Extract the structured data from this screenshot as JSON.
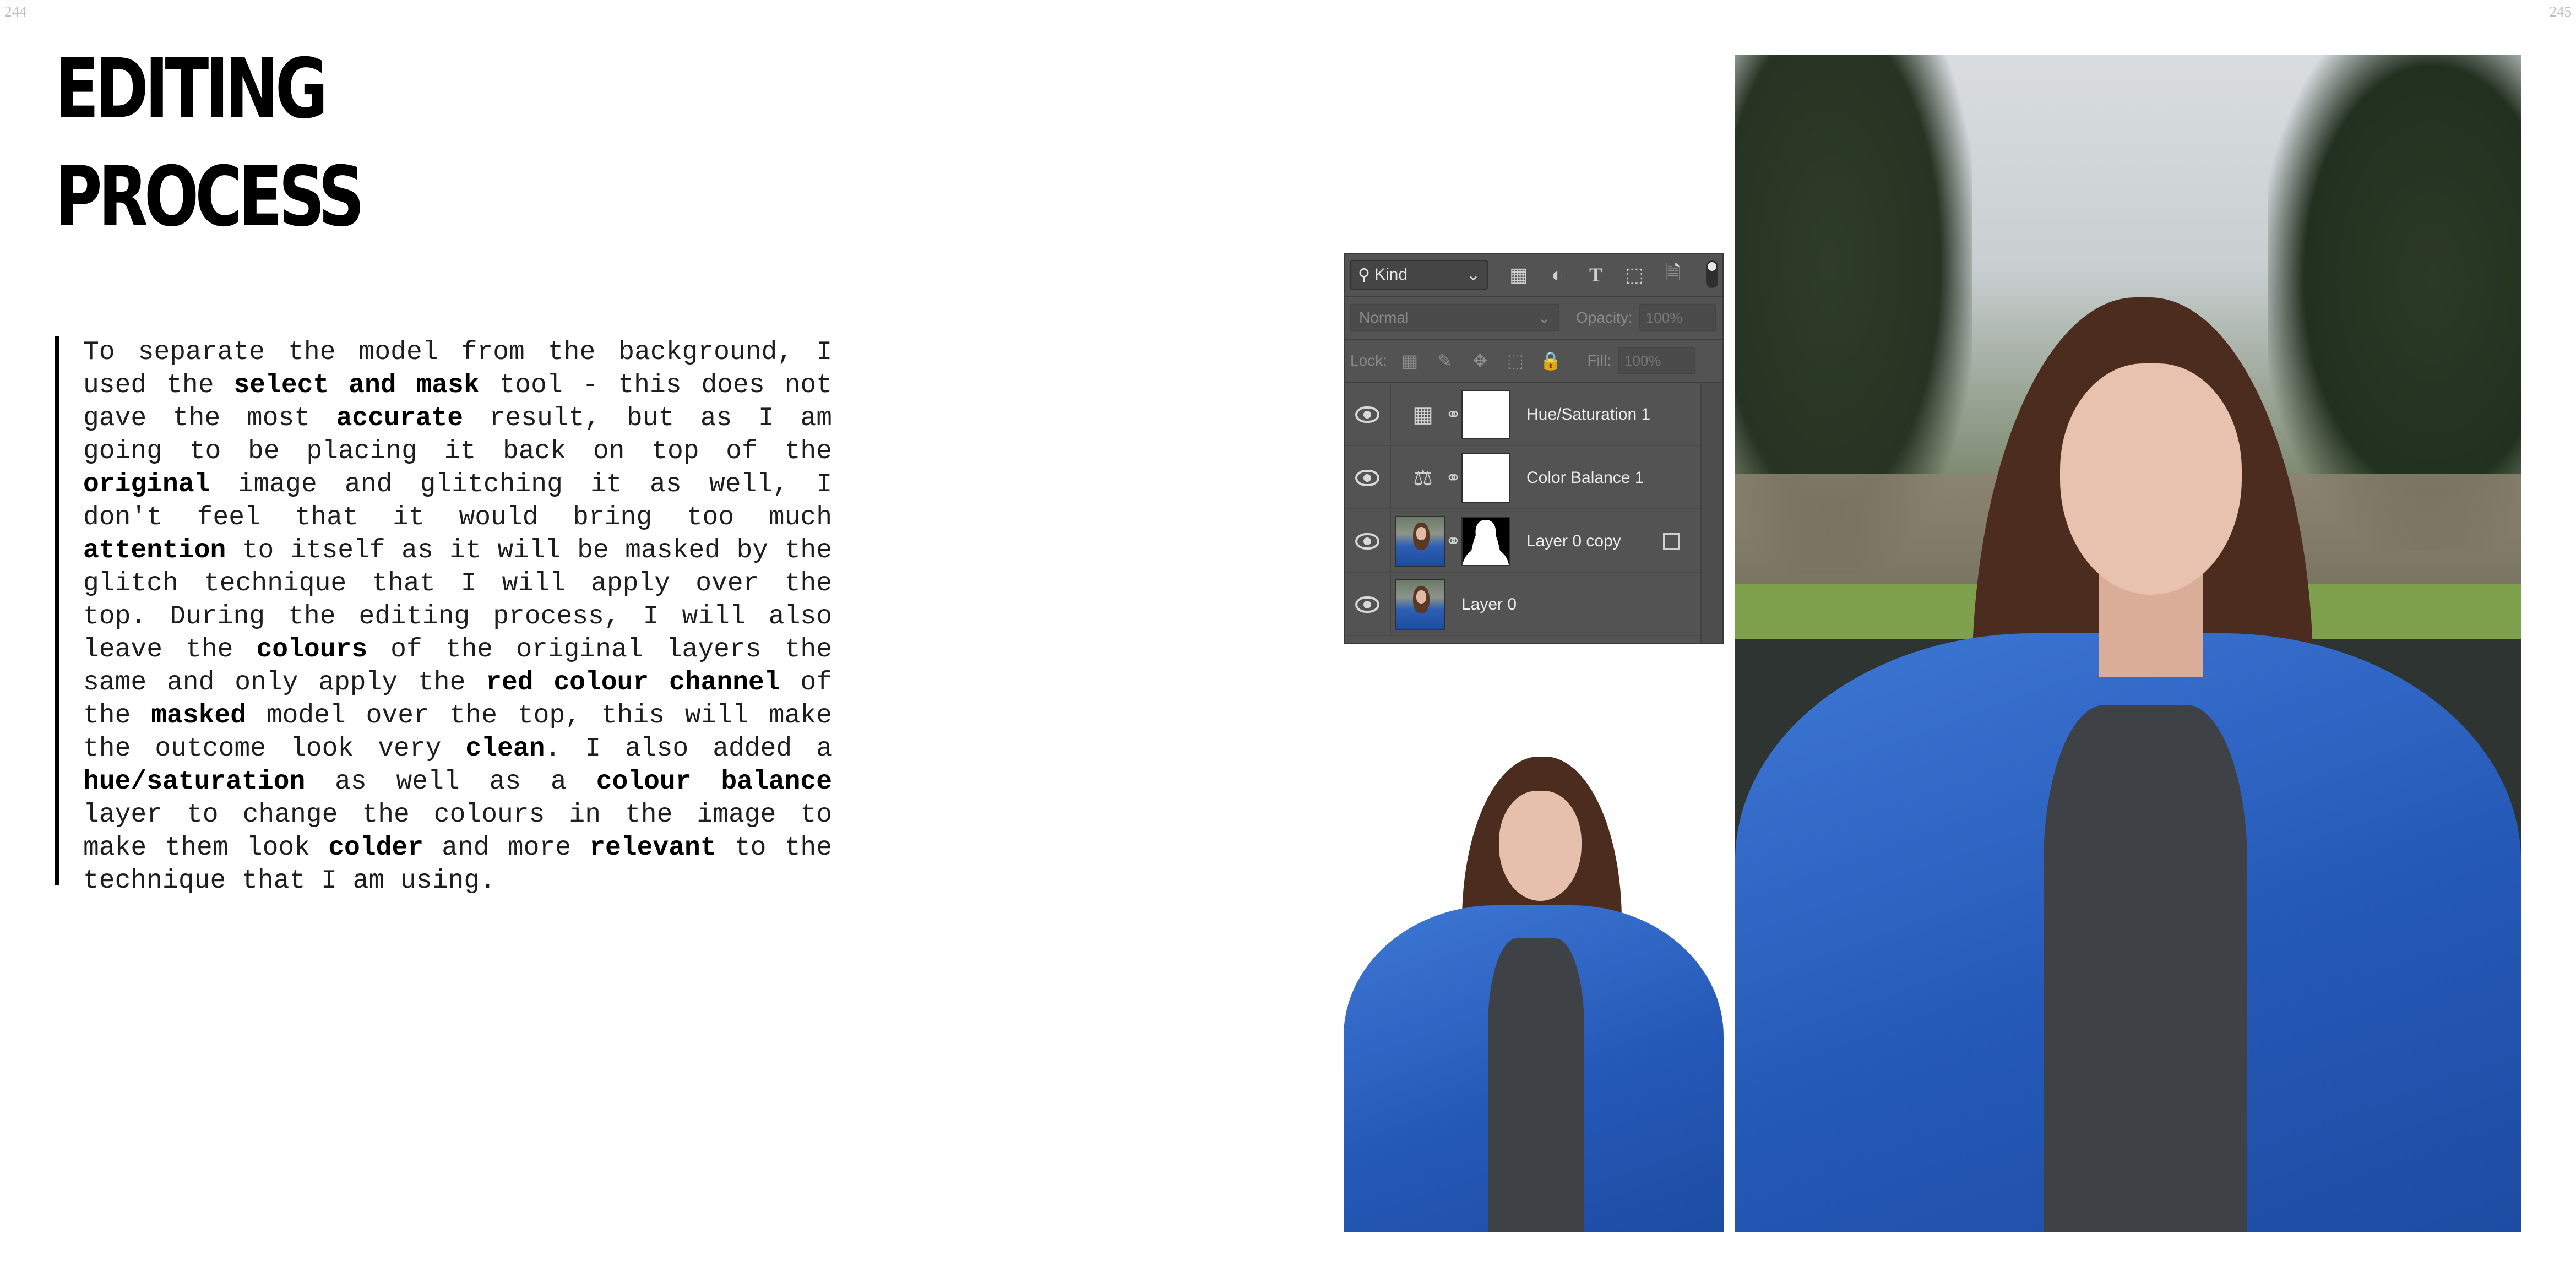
{
  "page_numbers": {
    "left": "244",
    "right": "245"
  },
  "title": {
    "line1": "EDITING",
    "line2": "PROCESS"
  },
  "body": {
    "segments": [
      {
        "t": "To separate the model from the background, I used the ",
        "b": false
      },
      {
        "t": "select and mask",
        "b": true
      },
      {
        "t": " tool - this does not gave the most ",
        "b": false
      },
      {
        "t": "accurate",
        "b": true
      },
      {
        "t": " result, but as I am going to be placing it back on top of the ",
        "b": false
      },
      {
        "t": "original",
        "b": true
      },
      {
        "t": " image and glitching it as well, I don't feel that it would bring too much ",
        "b": false
      },
      {
        "t": "attention",
        "b": true
      },
      {
        "t": " to itself as it will be masked by the glitch technique that I will apply over the top. During the editing process, I will also leave the ",
        "b": false
      },
      {
        "t": "colours",
        "b": true
      },
      {
        "t": " of the original layers the same and only apply the ",
        "b": false
      },
      {
        "t": "red colour channel",
        "b": true
      },
      {
        "t": " of the ",
        "b": false
      },
      {
        "t": "masked",
        "b": true
      },
      {
        "t": " model over the top, this will make the outcome look very ",
        "b": false
      },
      {
        "t": "clean",
        "b": true
      },
      {
        "t": ". I also added a ",
        "b": false
      },
      {
        "t": "hue/saturation",
        "b": true
      },
      {
        "t": " as well as a ",
        "b": false
      },
      {
        "t": "colour balance",
        "b": true
      },
      {
        "t": " layer to change the colours in the image to make them look ",
        "b": false
      },
      {
        "t": "colder",
        "b": true
      },
      {
        "t": " and more ",
        "b": false
      },
      {
        "t": "relevant",
        "b": true
      },
      {
        "t": " to the technique that I am using.",
        "b": false
      }
    ]
  },
  "layers_panel": {
    "filter_kind": "Kind",
    "blend_mode": "Normal",
    "opacity_label": "Opacity:",
    "opacity_value": "100%",
    "lock_label": "Lock:",
    "fill_label": "Fill:",
    "fill_value": "100%",
    "layers": [
      {
        "name": "Hue/Saturation 1",
        "kind": "adjustment",
        "icon": "hue-saturation-icon",
        "mask": "white"
      },
      {
        "name": "Color Balance 1",
        "kind": "adjustment",
        "icon": "color-balance-icon",
        "mask": "white"
      },
      {
        "name": "Layer 0 copy",
        "kind": "pixel-masked",
        "icon": "photo-thumbnail",
        "mask": "silhouette"
      },
      {
        "name": "Layer 0",
        "kind": "pixel",
        "icon": "photo-thumbnail",
        "mask": "none"
      }
    ]
  },
  "colors": {
    "panel_bg": "#535353",
    "jacket_blue": "#2559b8",
    "hair_brown": "#4b2c1e",
    "text": "#1e1e1e"
  }
}
